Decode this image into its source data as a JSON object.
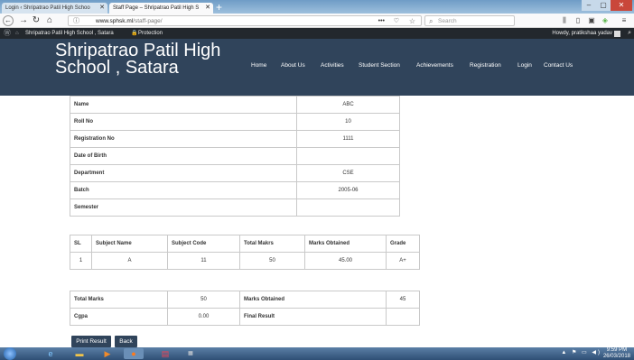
{
  "browser": {
    "tabs": [
      {
        "label": "Login ‹ Shripatrao Patil High Schoo",
        "active": false
      },
      {
        "label": "Staff Page – Shripatrao Patil High S",
        "active": true
      }
    ],
    "url_host": "www.sphsk.ml",
    "url_path": "/staff-page/",
    "search_placeholder": "Search",
    "icons": {
      "back": "back-arrow-icon",
      "forward": "forward-arrow-icon",
      "reload": "reload-icon",
      "home": "home-icon"
    }
  },
  "adminbar": {
    "site_name": "Shripatrao Patil High School , Satara",
    "protection": "Protection",
    "howdy": "Howdy, pratikshaa yadav"
  },
  "site": {
    "title": "Shripatrao Patil High School , Satara",
    "nav": [
      "Home",
      "About Us",
      "Activities",
      "Student Section",
      "Achievements",
      "Registration",
      "Login",
      "Contact Us"
    ],
    "colors": {
      "header_bg": "#30445b",
      "button_bg": "#30445b"
    }
  },
  "student_info": [
    {
      "label": "Name",
      "value": "ABC"
    },
    {
      "label": "Roll No",
      "value": "10"
    },
    {
      "label": "Registration No",
      "value": "1111"
    },
    {
      "label": "Date of Birth",
      "value": ""
    },
    {
      "label": "Department",
      "value": "CSE"
    },
    {
      "label": "Batch",
      "value": "2005-06"
    },
    {
      "label": "Semester",
      "value": ""
    }
  ],
  "subjects": {
    "headers": [
      "SL",
      "Subject Name",
      "Subject Code",
      "Total Makrs",
      "Marks Obtained",
      "Grade"
    ],
    "rows": [
      [
        "1",
        "A",
        "11",
        "50",
        "45.00",
        "A+"
      ]
    ]
  },
  "totals": {
    "total_marks_label": "Total Marks",
    "total_marks_value": "50",
    "marks_obtained_label": "Marks Obtained",
    "marks_obtained_value": "45",
    "cgpa_label": "Cgpa",
    "cgpa_value": "0.00",
    "final_result_label": "Final Result",
    "final_result_value": ""
  },
  "buttons": {
    "print_result": "Print Result",
    "back": "Back"
  },
  "taskbar": {
    "time": "9:59 PM",
    "date": "26/03/2018"
  }
}
